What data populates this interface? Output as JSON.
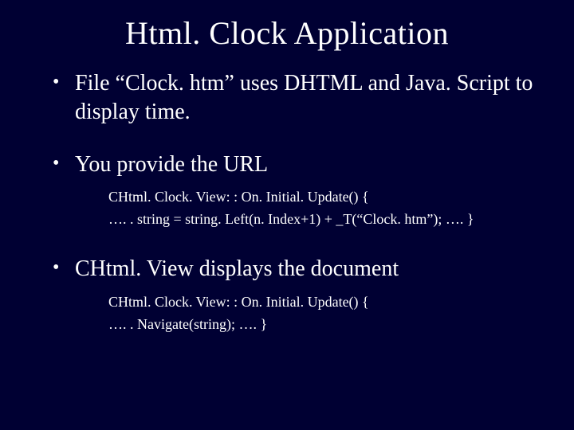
{
  "title": "Html. Clock Application",
  "bullets": [
    {
      "text": "File “Clock. htm” uses DHTML and Java. Script to display time.",
      "sub": []
    },
    {
      "text": "You provide the URL",
      "sub": [
        "CHtml. Clock. View: : On. Initial. Update() {",
        "…. . string = string. Left(n. Index+1) + _T(“Clock. htm”);  …. }"
      ]
    },
    {
      "text": "CHtml. View displays the document",
      "sub": [
        "CHtml. Clock. View: : On. Initial. Update() {",
        "…. . Navigate(string);  …. }"
      ]
    }
  ]
}
